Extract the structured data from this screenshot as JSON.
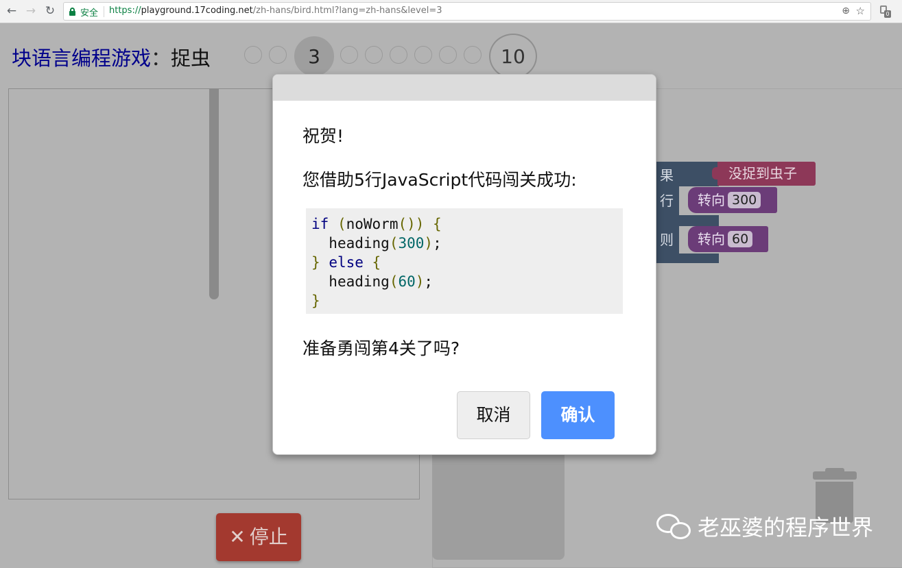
{
  "browser": {
    "secure_label": "安全",
    "url_scheme": "https://",
    "url_host": "playground.17coding.net",
    "url_path": "/zh-hans/bird.html?lang=zh-hans&level=3",
    "icons": [
      "back-icon",
      "forward-icon",
      "reload-icon",
      "lock-icon",
      "zoom-icon",
      "star-icon",
      "extension-icon"
    ]
  },
  "header": {
    "app_title": "块语言编程游戏",
    "separator": "：",
    "level_name": "捉虫",
    "current_level": "3",
    "last_level": "10"
  },
  "blocks": {
    "if_label": "果",
    "do_label": "行",
    "else_label": "则",
    "condition": "没捉到虫子",
    "turn1_label": "转向",
    "turn1_value": "300",
    "turn2_label": "转向",
    "turn2_value": "60"
  },
  "stop_button": {
    "label": "停止"
  },
  "watermark": {
    "text": "老巫婆的程序世界"
  },
  "dialog": {
    "congrats": "祝贺!",
    "summary": "您借助5行JavaScript代码闯关成功:",
    "code": {
      "kw_if": "if",
      "call": "noWorm",
      "heading1_fn": "heading",
      "heading1_arg": "300",
      "kw_else": "else",
      "heading2_fn": "heading",
      "heading2_arg": "60"
    },
    "prompt": "准备勇闯第4关了吗?",
    "cancel_label": "取消",
    "ok_label": "确认"
  },
  "colors": {
    "accent_blue": "#4d90fe",
    "stop_red": "#a3392f",
    "title_blue": "#00008b",
    "logic_block": "#3d4f65",
    "condition_block": "#8d3858",
    "turn_block": "#6b3c78"
  }
}
